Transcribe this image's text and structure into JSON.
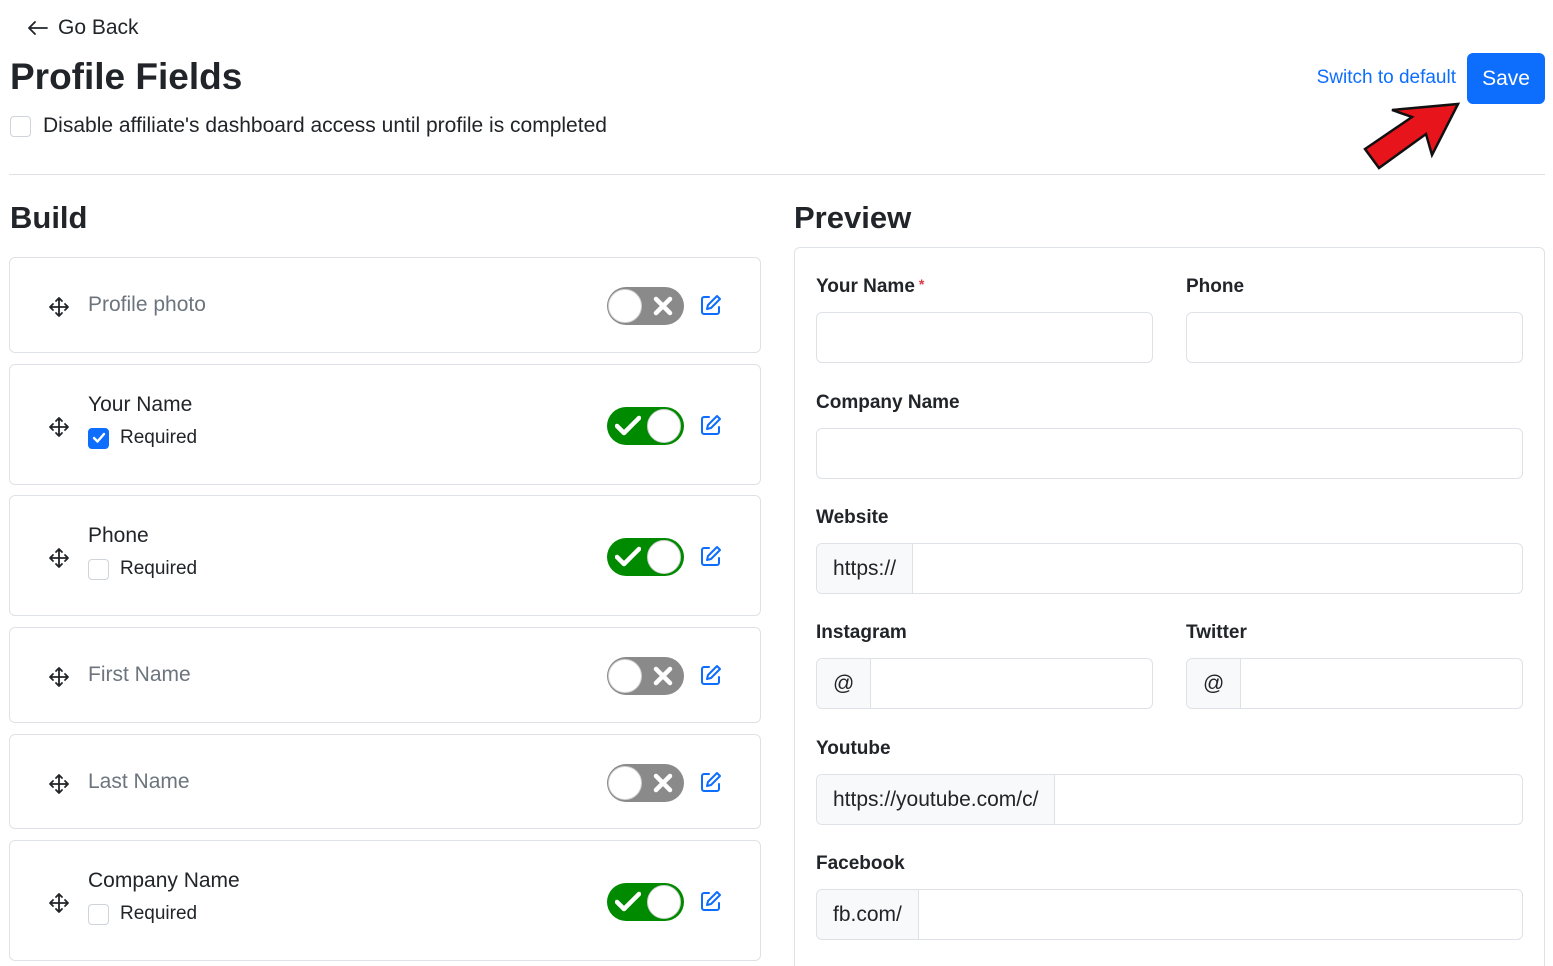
{
  "header": {
    "go_back": "Go Back",
    "title": "Profile Fields",
    "disable_access_label": "Disable affiliate's dashboard access until profile is completed",
    "disable_access_checked": false,
    "switch_default": "Switch to default",
    "save": "Save"
  },
  "build": {
    "title": "Build",
    "required_label": "Required",
    "fields": [
      {
        "label": "Profile photo",
        "enabled": false,
        "has_required": false
      },
      {
        "label": "Your Name",
        "enabled": true,
        "has_required": true,
        "required": true
      },
      {
        "label": "Phone",
        "enabled": true,
        "has_required": true,
        "required": false
      },
      {
        "label": "First Name",
        "enabled": false,
        "has_required": false
      },
      {
        "label": "Last Name",
        "enabled": false,
        "has_required": false
      },
      {
        "label": "Company Name",
        "enabled": true,
        "has_required": true,
        "required": false
      }
    ]
  },
  "preview": {
    "title": "Preview",
    "your_name": "Your Name",
    "required_star": "*",
    "phone": "Phone",
    "company_name": "Company Name",
    "website": "Website",
    "website_prefix": "https://",
    "instagram": "Instagram",
    "instagram_prefix": "@",
    "twitter": "Twitter",
    "twitter_prefix": "@",
    "youtube": "Youtube",
    "youtube_prefix": "https://youtube.com/c/",
    "facebook": "Facebook",
    "facebook_prefix": "fb.com/"
  },
  "colors": {
    "primary": "#0d6efd",
    "toggle_on": "#008a00",
    "toggle_off": "#8a8a8a",
    "annotation_arrow": "#e8141c",
    "required_star": "#dc3545"
  },
  "icons": {
    "back": "arrow-left-icon",
    "drag": "move-icon",
    "edit": "edit-icon",
    "on": "check-icon",
    "off": "x-icon"
  }
}
